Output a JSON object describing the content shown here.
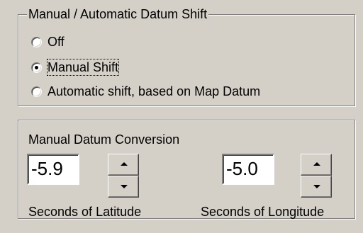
{
  "datum_shift_group": {
    "title": "Manual / Automatic Datum Shift",
    "options": [
      {
        "label": "Off",
        "selected": false
      },
      {
        "label": "Manual Shift",
        "selected": true
      },
      {
        "label": "Automatic shift, based on Map Datum",
        "selected": false
      }
    ]
  },
  "conversion_panel": {
    "title": "Manual Datum Conversion",
    "latitude": {
      "value": "-5.9",
      "caption": "Seconds of Latitude"
    },
    "longitude": {
      "value": "-5.0",
      "caption": "Seconds of Longitude"
    }
  },
  "icons": {
    "spin_up": "up-arrow-icon",
    "spin_down": "down-arrow-icon"
  }
}
